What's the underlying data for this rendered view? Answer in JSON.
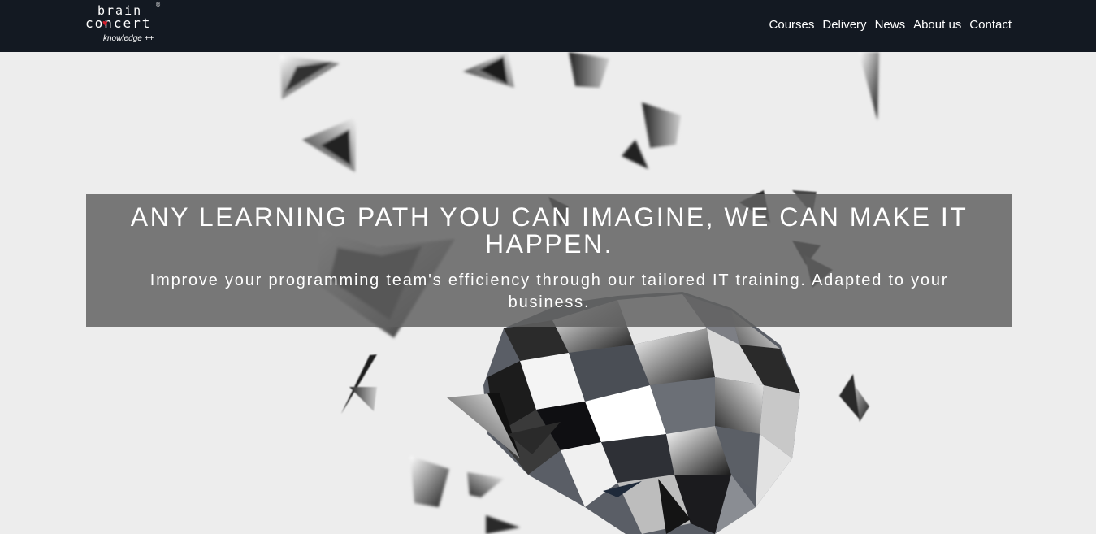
{
  "header": {
    "logo": {
      "line1": "brain",
      "line2": "concert",
      "tagline": "knowledge ++",
      "registered": "®"
    },
    "nav": [
      {
        "label": "Courses"
      },
      {
        "label": "Delivery"
      },
      {
        "label": "News"
      },
      {
        "label": "About us"
      },
      {
        "label": "Contact"
      }
    ]
  },
  "hero": {
    "title": "ANY LEARNING PATH YOU CAN IMAGINE, WE CAN MAKE IT HAPPEN.",
    "subtitle": "Improve your programming team's efficiency through our tailored IT training. Adapted to your business."
  },
  "colors": {
    "navbar": "#131922",
    "background": "#ededed",
    "banner": "#606060",
    "logo_accent": "#d61f2d"
  }
}
